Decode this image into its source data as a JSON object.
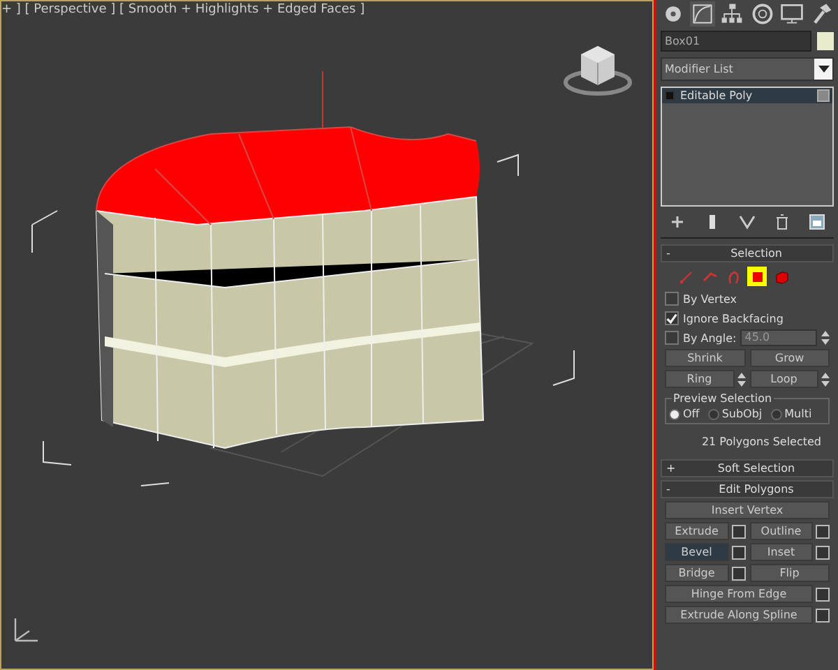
{
  "viewport": {
    "label": "+ ] [ Perspective ] [ Smooth + Highlights + Edged Faces ]"
  },
  "object_name": {
    "value": "Box01"
  },
  "modifier_list": {
    "value": "Modifier List"
  },
  "stack": [
    {
      "label": "Editable Poly",
      "selected": true
    }
  ],
  "rollouts": [
    {
      "kind": "selection",
      "toggle": "-",
      "title": "Selection",
      "levels": [
        {
          "selected": false
        },
        {
          "selected": false
        },
        {
          "selected": false
        },
        {
          "selected": true
        },
        {
          "selected": false
        }
      ],
      "checks": [
        {
          "label": "By Vertex",
          "checked": false
        },
        {
          "label": "Ignore Backfacing",
          "checked": true
        }
      ],
      "angle": {
        "label": "By Angle:",
        "checked": false,
        "value": "45.0"
      },
      "buttons": [
        {
          "label": "Shrink",
          "spinner": false
        },
        {
          "label": "Grow",
          "spinner": false
        },
        {
          "label": "Ring",
          "spinner": true
        },
        {
          "label": "Loop",
          "spinner": true
        }
      ],
      "preview": {
        "title": "Preview Selection",
        "options": [
          {
            "label": "Off",
            "selected": true
          },
          {
            "label": "SubObj",
            "selected": false
          },
          {
            "label": "Multi",
            "selected": false
          }
        ]
      },
      "status": "21 Polygons Selected"
    },
    {
      "kind": "header",
      "toggle": "+",
      "title": "Soft Selection"
    },
    {
      "kind": "edit",
      "toggle": "-",
      "title": "Edit Polygons",
      "rows": [
        [
          {
            "label": "Insert Vertex",
            "settings": false,
            "pressed": false
          }
        ],
        [
          {
            "label": "Extrude",
            "settings": true,
            "pressed": false
          },
          {
            "label": "Outline",
            "settings": true,
            "pressed": false
          }
        ],
        [
          {
            "label": "Bevel",
            "settings": true,
            "pressed": true
          },
          {
            "label": "Inset",
            "settings": true,
            "pressed": false
          }
        ],
        [
          {
            "label": "Bridge",
            "settings": true,
            "pressed": false
          },
          {
            "label": "Flip",
            "settings": false,
            "pressed": false
          }
        ],
        [
          {
            "label": "Hinge From Edge",
            "settings": true,
            "pressed": false
          }
        ],
        [
          {
            "label": "Extrude Along Spline",
            "settings": true,
            "pressed": false
          }
        ]
      ]
    }
  ]
}
